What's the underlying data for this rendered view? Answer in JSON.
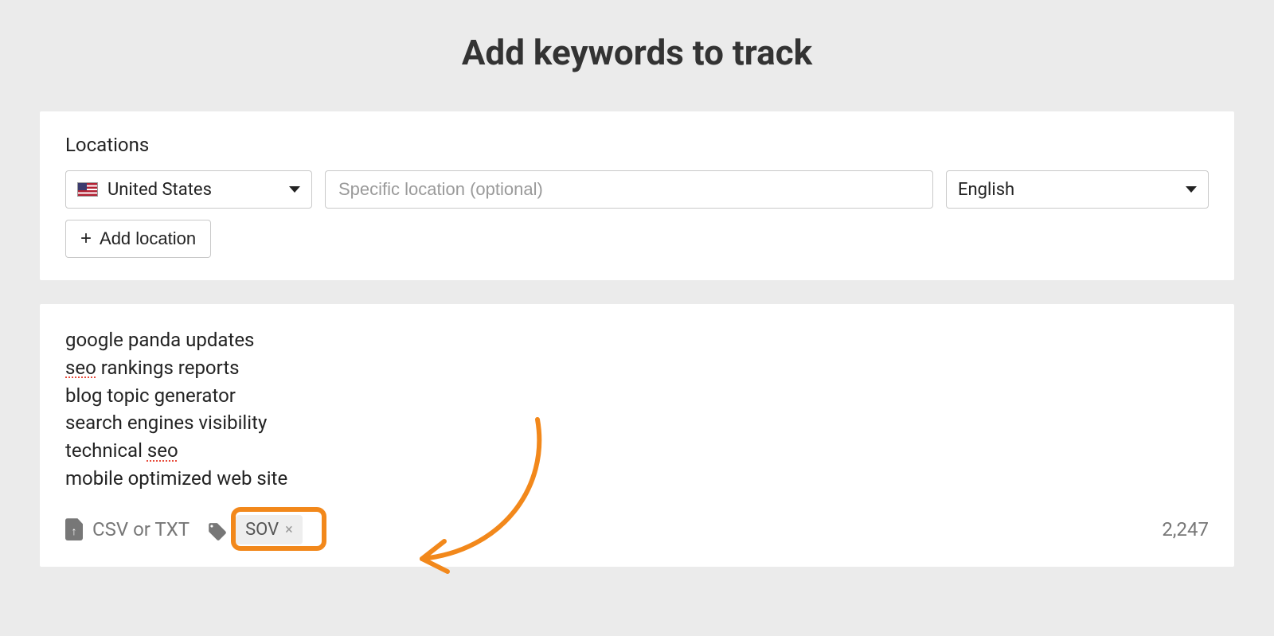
{
  "page": {
    "title": "Add keywords to track"
  },
  "locations": {
    "label": "Locations",
    "country": "United States",
    "specific_placeholder": "Specific location (optional)",
    "language": "English",
    "add_location_label": "Add location"
  },
  "keywords": {
    "lines": [
      "google panda updates",
      "seo rankings reports",
      "blog topic generator",
      "search engines visibility",
      "technical seo",
      "mobile optimized web site"
    ]
  },
  "footer": {
    "upload_label": "CSV or TXT",
    "tag": "SOV",
    "count": "2,247"
  }
}
